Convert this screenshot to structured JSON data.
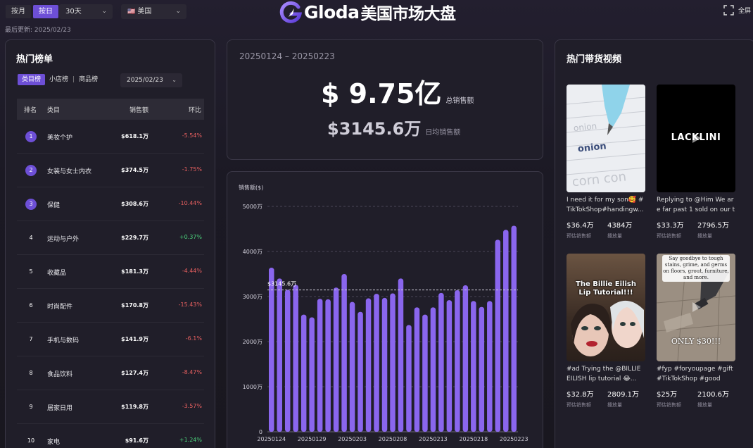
{
  "topbar": {
    "toggle": [
      "按月",
      "按日"
    ],
    "toggle_active": 1,
    "period": "30天",
    "country": "美国",
    "country_flag": "🇺🇸",
    "updated": "最后更新: 2025/02/23",
    "brand": "Gloda",
    "brand_suffix": "美国市场大盘",
    "fullscreen": "全屏"
  },
  "left": {
    "title": "热门榜单",
    "tabs": [
      "类目榜",
      "小店榜",
      "商品榜"
    ],
    "date": "2025/02/23",
    "headers": {
      "rank": "排名",
      "category": "类目",
      "sales": "销售额",
      "change": "环比"
    },
    "rows": [
      {
        "rank": "1",
        "category": "美妆个护",
        "sales": "$618.1万",
        "change": "-5.54%",
        "dir": "neg"
      },
      {
        "rank": "2",
        "category": "女装与女士内衣",
        "sales": "$374.5万",
        "change": "-1.75%",
        "dir": "neg"
      },
      {
        "rank": "3",
        "category": "保健",
        "sales": "$308.6万",
        "change": "-10.44%",
        "dir": "neg"
      },
      {
        "rank": "4",
        "category": "运动与户外",
        "sales": "$229.7万",
        "change": "+0.37%",
        "dir": "pos"
      },
      {
        "rank": "5",
        "category": "收藏品",
        "sales": "$181.3万",
        "change": "-4.44%",
        "dir": "neg"
      },
      {
        "rank": "6",
        "category": "时尚配件",
        "sales": "$170.8万",
        "change": "-15.43%",
        "dir": "neg"
      },
      {
        "rank": "7",
        "category": "手机与数码",
        "sales": "$141.9万",
        "change": "-6.1%",
        "dir": "neg"
      },
      {
        "rank": "8",
        "category": "食品饮料",
        "sales": "$127.4万",
        "change": "-8.47%",
        "dir": "neg"
      },
      {
        "rank": "9",
        "category": "居家日用",
        "sales": "$119.8万",
        "change": "-3.57%",
        "dir": "neg"
      },
      {
        "rank": "10",
        "category": "家电",
        "sales": "$91.6万",
        "change": "+1.24%",
        "dir": "pos"
      }
    ]
  },
  "summary": {
    "range": "20250124 – 20250223",
    "total": "$ 9.75亿",
    "total_label": "总销售额",
    "daily": "$3145.6万",
    "daily_label": "日均销售额"
  },
  "chart_data": {
    "type": "bar",
    "ylabel": "销售额($)",
    "ylim": [
      0,
      5000
    ],
    "yticks": [
      "0",
      "1000万",
      "2000万",
      "3000万",
      "4000万",
      "5000万"
    ],
    "xtick_labels": [
      "20250124",
      "20250129",
      "20250203",
      "20250208",
      "20250213",
      "20250218",
      "20250223"
    ],
    "categories": [
      "20250124",
      "20250125",
      "20250126",
      "20250127",
      "20250128",
      "20250129",
      "20250130",
      "20250131",
      "20250201",
      "20250202",
      "20250203",
      "20250204",
      "20250205",
      "20250206",
      "20250207",
      "20250208",
      "20250209",
      "20250210",
      "20250211",
      "20250212",
      "20250213",
      "20250214",
      "20250215",
      "20250216",
      "20250217",
      "20250218",
      "20250219",
      "20250220",
      "20250221",
      "20250222",
      "20250223"
    ],
    "values": [
      3640,
      3400,
      3150,
      3260,
      2600,
      2540,
      2950,
      2940,
      3200,
      3500,
      2880,
      2660,
      2960,
      3060,
      2970,
      3070,
      3400,
      2370,
      2760,
      2600,
      2760,
      3080,
      2920,
      3140,
      3250,
      2900,
      2770,
      2900,
      4260,
      4480,
      4570
    ],
    "avg_line": {
      "value": 3145.6,
      "label": "$3145.6万"
    },
    "color": "#8a66ee"
  },
  "right": {
    "title": "热门带货视频",
    "videos": [
      {
        "caption": "I need it for my son🥰 #TikTokShop#handingw...",
        "sales": "$36.4万",
        "sales_label": "预估销售额",
        "plays": "4384万",
        "plays_label": "播放量"
      },
      {
        "caption": "Replying to @Him We are far past 1 sold on our ti...",
        "sales": "$33.3万",
        "sales_label": "预估销售额",
        "plays": "2796.5万",
        "plays_label": "播放量",
        "thumb_text": "LACKLINI"
      },
      {
        "caption": "#ad Trying the @BILLIE EILISH lip tutorial 😂...",
        "sales": "$32.8万",
        "sales_label": "预估销售额",
        "plays": "2809.1万",
        "plays_label": "播放量",
        "thumb_text": "The Billie Eilish Lip Tutorial!!!"
      },
      {
        "caption": "#fyp #foryoupage #gift #TikTokShop #good",
        "sales": "$25万",
        "sales_label": "预估销售额",
        "plays": "2100.6万",
        "plays_label": "播放量",
        "thumb_text": "Say goodbye to tough stains, grime, and germs on floors, grout, furniture, and more.",
        "thumb_text2": "ONLY $30!!!"
      }
    ]
  }
}
